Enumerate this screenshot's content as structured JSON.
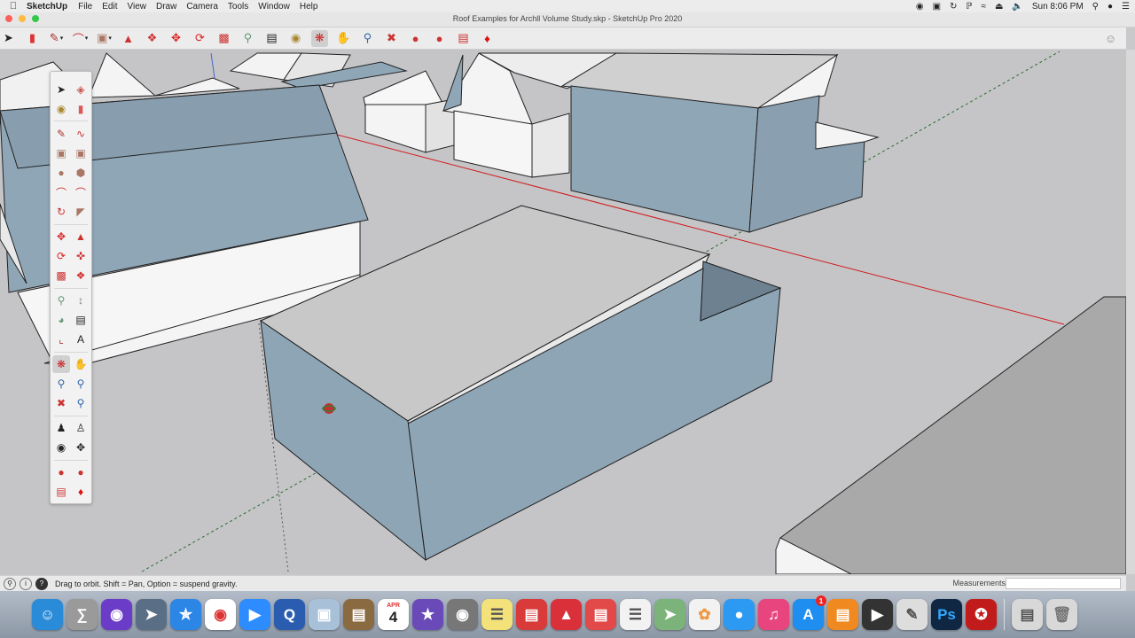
{
  "menubar": {
    "apple": "",
    "app_name": "SketchUp",
    "items": [
      "File",
      "Edit",
      "View",
      "Draw",
      "Camera",
      "Tools",
      "Window",
      "Help"
    ],
    "clock": "Sun 8:06 PM"
  },
  "window": {
    "title": "Roof Examples for Archll Volume Study.skp - SketchUp Pro 2020"
  },
  "toolbar": {
    "tools": [
      {
        "name": "select-tool",
        "icon": "arrow-icon"
      },
      {
        "name": "eraser-tool",
        "icon": "eraser-icon"
      },
      {
        "name": "line-tool",
        "icon": "pencil-icon"
      },
      {
        "name": "arc-tool",
        "icon": "arc-icon"
      },
      {
        "name": "rectangle-tool",
        "icon": "rectangle-icon"
      },
      {
        "name": "push-pull-tool",
        "icon": "push-pull-icon"
      },
      {
        "name": "offset-tool",
        "icon": "offset-icon"
      },
      {
        "name": "move-tool",
        "icon": "move-icon"
      },
      {
        "name": "rotate-tool",
        "icon": "rotate-icon"
      },
      {
        "name": "scale-tool",
        "icon": "scale-icon"
      },
      {
        "name": "tape-measure-tool",
        "icon": "tape-icon"
      },
      {
        "name": "text-tool",
        "icon": "text-icon"
      },
      {
        "name": "paint-bucket-tool",
        "icon": "paint-bucket-icon"
      },
      {
        "name": "orbit-tool",
        "icon": "orbit-icon"
      },
      {
        "name": "pan-tool",
        "icon": "pan-icon"
      },
      {
        "name": "zoom-tool",
        "icon": "zoom-icon"
      },
      {
        "name": "zoom-extents-tool",
        "icon": "zoom-extents-icon"
      },
      {
        "name": "warehouse-tool",
        "icon": "warehouse-icon"
      },
      {
        "name": "extension-warehouse-tool",
        "icon": "extension-icon"
      },
      {
        "name": "layout-tool",
        "icon": "layout-icon"
      },
      {
        "name": "extension-manager-tool",
        "icon": "ruby-icon"
      }
    ]
  },
  "status": {
    "hint": "Drag to orbit. Shift = Pan, Option = suspend gravity.",
    "measurements_label": "Measurements",
    "measurements_value": ""
  },
  "dock": {
    "calendar_month": "APR",
    "calendar_day": "4",
    "appstore_badge": "1",
    "ps_label": "Ps"
  },
  "colors": {
    "accent_blue": "#8ea5b5",
    "roof_gray": "#c8c8c8",
    "axis_red": "#d11a1a"
  }
}
